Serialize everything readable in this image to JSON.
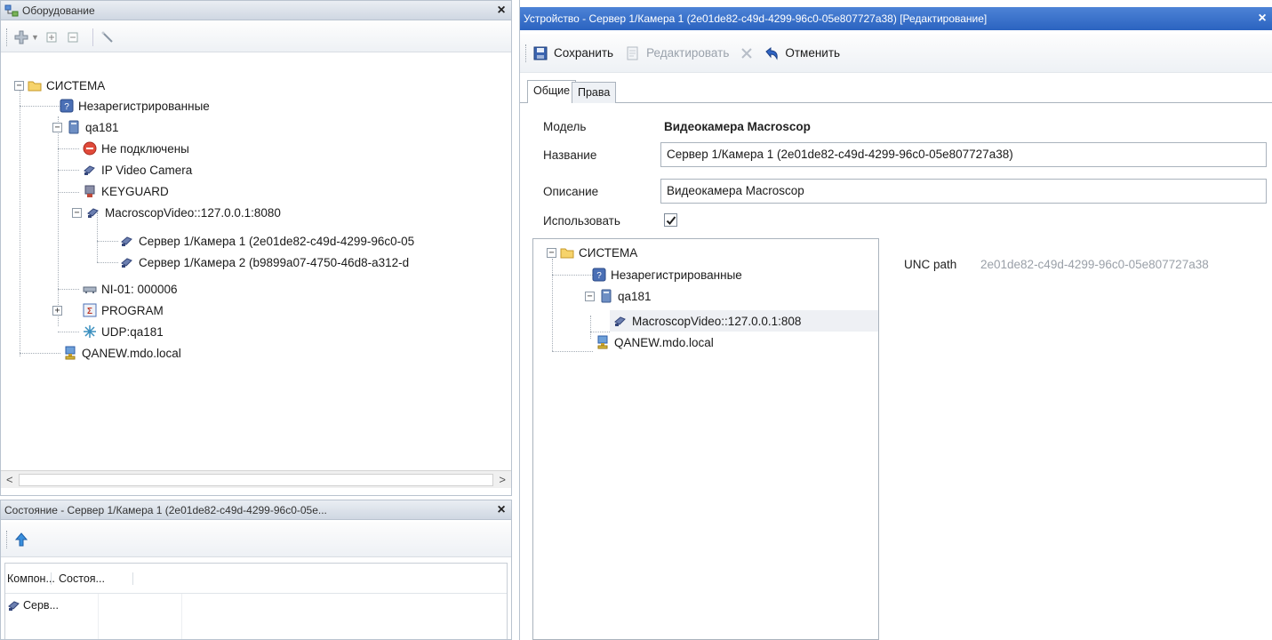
{
  "equipment_panel": {
    "title": "Оборудование",
    "close": "×"
  },
  "tree": {
    "root": "СИСТЕМА",
    "unregistered": "Незарегистрированные",
    "host": "qa181",
    "not_connected": "Не подключены",
    "ip_video_camera": "IP Video Camera",
    "keyguard": "KEYGUARD",
    "macroscop_video": "MacroscopVideo::127.0.0.1:8080",
    "camera_1": "Сервер 1/Камера 1 (2e01de82-c49d-4299-96c0-05",
    "camera_2": "Сервер 1/Камера 2 (b9899a07-4750-46d8-a312-d",
    "ni01": "NI-01: 000006",
    "program": "PROGRAM",
    "udp": "UDP:qa181",
    "qanew": "QANEW.mdo.local"
  },
  "status_panel": {
    "title": "Состояние - Сервер 1/Камера 1 (2e01de82-c49d-4299-96c0-05e...",
    "close": "×",
    "columns": [
      "Компон...",
      "Состоя..."
    ],
    "rows": [
      {
        "component": "Серв...",
        "state": ""
      }
    ]
  },
  "device_panel": {
    "title": "Устройство - Сервер 1/Камера 1 (2e01de82-c49d-4299-96c0-05e807727a38) [Редактирование]",
    "close": "×",
    "toolbar": {
      "save": "Сохранить",
      "edit": "Редактировать",
      "cancel": "Отменить"
    },
    "tabs": [
      "Общие",
      "Права"
    ],
    "fields": {
      "model_label": "Модель",
      "model_value": "Видеокамера Macroscop",
      "name_label": "Название",
      "name_value": "Сервер 1/Камера 1 (2e01de82-c49d-4299-96c0-05e807727a38)",
      "desc_label": "Описание",
      "desc_value": "Видеокамера Macroscop",
      "use_label": "Использовать",
      "use_checked": true
    },
    "parent_tree": {
      "root": "СИСТЕМА",
      "unregistered": "Незарегистрированные",
      "host": "qa181",
      "macroscop": "MacroscopVideo::127.0.0.1:808",
      "qanew": "QANEW.mdo.local"
    },
    "unc_label": "UNC path",
    "unc_value": "2e01de82-c49d-4299-96c0-05e807727a38"
  },
  "scroll": {
    "left": "<",
    "right": ">"
  },
  "colors": {
    "accent": "#2b63c0",
    "selection": "#dde8f7"
  }
}
